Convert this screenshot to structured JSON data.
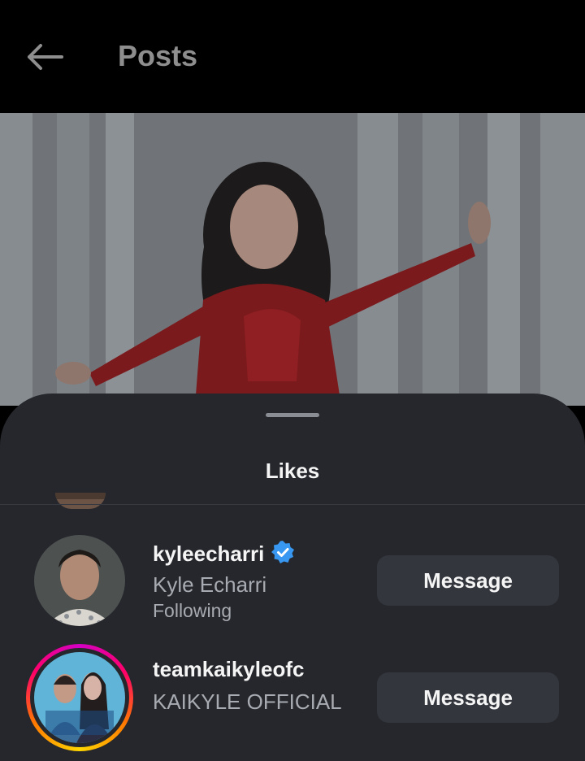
{
  "header": {
    "title": "Posts",
    "back_icon": "arrow-left-icon"
  },
  "sheet": {
    "title": "Likes"
  },
  "likes": [
    {
      "username": "kyleecharri",
      "verified": true,
      "full_name": "Kyle Echarri",
      "status": "Following",
      "button_label": "Message",
      "story_ring": false
    },
    {
      "username": "teamkaikyleofc",
      "verified": false,
      "full_name": "KAIKYLE OFFICIAL",
      "status": "",
      "button_label": "Message",
      "story_ring": true,
      "avatar_text": "KAIKYLE OFFICIAL"
    }
  ],
  "colors": {
    "sheet_bg": "#25272c",
    "button_bg": "#33363d",
    "verified_badge": "#3897f0",
    "secondary_text": "#a8abb1"
  }
}
